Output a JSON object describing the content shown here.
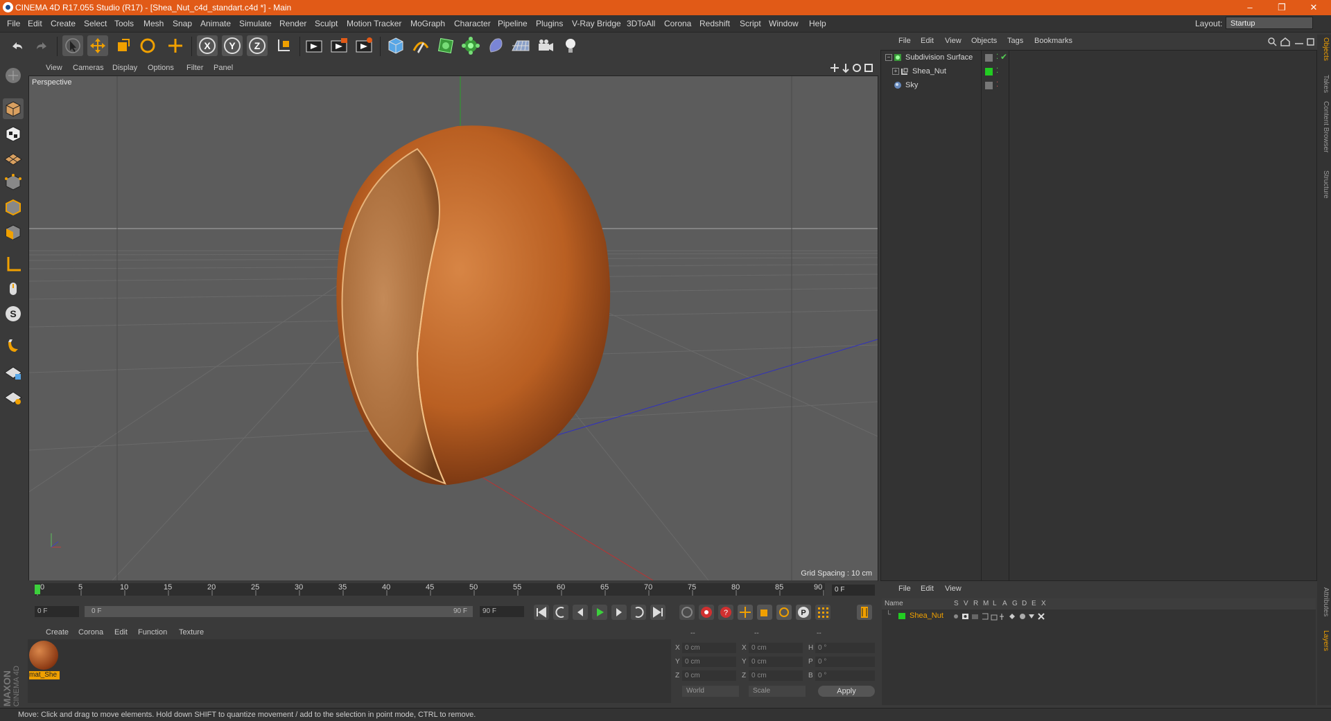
{
  "app": {
    "title": "CINEMA 4D R17.055 Studio (R17) - [Shea_Nut_c4d_standart.c4d *] - Main",
    "window_controls": [
      "–",
      "❐",
      "✕"
    ]
  },
  "menubar": {
    "items": [
      "File",
      "Edit",
      "Create",
      "Select",
      "Tools",
      "Mesh",
      "Snap",
      "Animate",
      "Simulate",
      "Render",
      "Sculpt",
      "Motion Tracker",
      "MoGraph",
      "Character",
      "Pipeline",
      "Plugins",
      "V-Ray Bridge",
      "3DToAll",
      "Corona",
      "Redshift",
      "Script",
      "Window",
      "Help"
    ],
    "layout_label": "Layout:",
    "layout_value": "Startup"
  },
  "toolbar": {
    "axis_x": "X",
    "axis_y": "Y",
    "axis_z": "Z"
  },
  "viewport": {
    "menu": [
      "View",
      "Cameras",
      "Display",
      "Options",
      "Filter",
      "Panel"
    ],
    "label": "Perspective",
    "grid_spacing": "Grid Spacing : 10 cm"
  },
  "timeline": {
    "ticks": [
      "0",
      "5",
      "10",
      "15",
      "20",
      "25",
      "30",
      "35",
      "40",
      "45",
      "50",
      "55",
      "60",
      "65",
      "70",
      "75",
      "80",
      "85",
      "90"
    ],
    "current_frame": "0 F",
    "start_field": "0 F",
    "range_start": "0 F",
    "range_end": "90 F",
    "end_field": "90 F"
  },
  "material_manager": {
    "menu": [
      "Create",
      "Corona",
      "Edit",
      "Function",
      "Texture"
    ],
    "material_name": "mat_She"
  },
  "coordinates": {
    "header": [
      "--",
      "--",
      "--"
    ],
    "rows": [
      {
        "l1": "X",
        "v1": "0 cm",
        "l2": "X",
        "v2": "0 cm",
        "l3": "H",
        "v3": "0 °"
      },
      {
        "l1": "Y",
        "v1": "0 cm",
        "l2": "Y",
        "v2": "0 cm",
        "l3": "P",
        "v3": "0 °"
      },
      {
        "l1": "Z",
        "v1": "0 cm",
        "l2": "Z",
        "v2": "0 cm",
        "l3": "B",
        "v3": "0 °"
      }
    ],
    "mode": "World",
    "scale": "Scale",
    "apply": "Apply"
  },
  "object_manager": {
    "menu": [
      "File",
      "Edit",
      "View",
      "Objects",
      "Tags",
      "Bookmarks"
    ],
    "objects": [
      {
        "name": "Subdivision Surface",
        "color": "#3a9a3a"
      },
      {
        "name": "Shea_Nut",
        "color": "#22cc22"
      },
      {
        "name": "Sky",
        "color": "#6688bb"
      }
    ]
  },
  "attribute_manager": {
    "menu": [
      "File",
      "Edit",
      "View"
    ],
    "columns": [
      "Name",
      "S",
      "V",
      "R",
      "M",
      "L",
      "A",
      "G",
      "D",
      "E",
      "X"
    ],
    "row_name": "Shea_Nut"
  },
  "right_tabs": [
    "Objects",
    "Takes",
    "Content Browser",
    "Structure",
    "Attributes",
    "Layers"
  ],
  "branding": {
    "maxon": "MAXON",
    "c4d": "CINEMA 4D"
  },
  "status": "Move: Click and drag to move elements. Hold down SHIFT to quantize movement / add to the selection in point mode, CTRL to remove."
}
